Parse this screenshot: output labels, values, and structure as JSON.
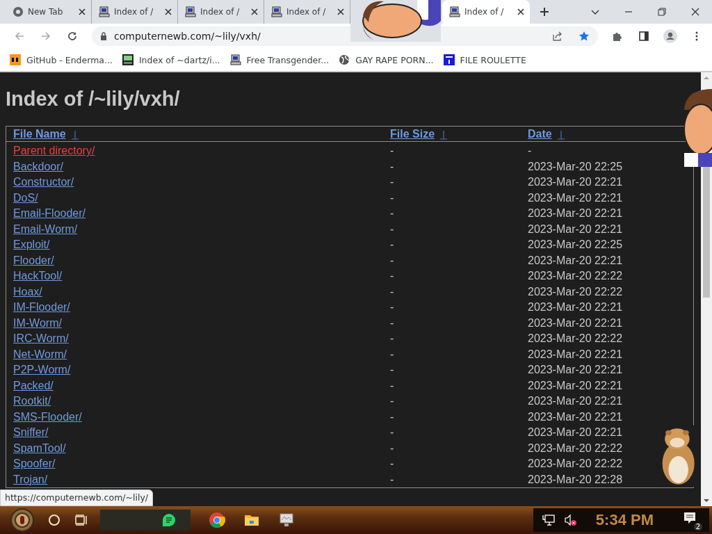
{
  "browser": {
    "tabs": [
      {
        "title": "New Tab",
        "kind": "newtab",
        "selected": false
      },
      {
        "title": "Index of /",
        "kind": "page",
        "selected": false
      },
      {
        "title": "Index of /",
        "kind": "page",
        "selected": false
      },
      {
        "title": "Index of /",
        "kind": "page",
        "selected": false
      },
      {
        "title": "Index of /",
        "kind": "page",
        "selected": true
      }
    ],
    "address": "computernewb.com/~lily/vxh/",
    "bookmarks": [
      {
        "title": "GitHub - Enderma...",
        "kind": "ph"
      },
      {
        "title": "Index of ~dartz/i...",
        "kind": "grid"
      },
      {
        "title": "Free Transgender...",
        "kind": "computer"
      },
      {
        "title": "GAY RAPE PORN...",
        "kind": "globe"
      },
      {
        "title": "FILE ROULETTE",
        "kind": "mft"
      }
    ]
  },
  "page": {
    "title": "Index of /~lily/vxh/",
    "columns": [
      "File Name",
      "File Size",
      "Date"
    ],
    "rows": [
      {
        "name": "Parent directory/",
        "size": "-",
        "date": "-",
        "visited": true
      },
      {
        "name": "Backdoor/",
        "size": "-",
        "date": "2023-Mar-20 22:25",
        "visited": false
      },
      {
        "name": "Constructor/",
        "size": "-",
        "date": "2023-Mar-20 22:21",
        "visited": false
      },
      {
        "name": "DoS/",
        "size": "-",
        "date": "2023-Mar-20 22:21",
        "visited": false
      },
      {
        "name": "Email-Flooder/",
        "size": "-",
        "date": "2023-Mar-20 22:21",
        "visited": false
      },
      {
        "name": "Email-Worm/",
        "size": "-",
        "date": "2023-Mar-20 22:21",
        "visited": false
      },
      {
        "name": "Exploit/",
        "size": "-",
        "date": "2023-Mar-20 22:25",
        "visited": false
      },
      {
        "name": "Flooder/",
        "size": "-",
        "date": "2023-Mar-20 22:21",
        "visited": false
      },
      {
        "name": "HackTool/",
        "size": "-",
        "date": "2023-Mar-20 22:22",
        "visited": false
      },
      {
        "name": "Hoax/",
        "size": "-",
        "date": "2023-Mar-20 22:22",
        "visited": false
      },
      {
        "name": "IM-Flooder/",
        "size": "-",
        "date": "2023-Mar-20 22:21",
        "visited": false
      },
      {
        "name": "IM-Worm/",
        "size": "-",
        "date": "2023-Mar-20 22:21",
        "visited": false
      },
      {
        "name": "IRC-Worm/",
        "size": "-",
        "date": "2023-Mar-20 22:22",
        "visited": false
      },
      {
        "name": "Net-Worm/",
        "size": "-",
        "date": "2023-Mar-20 22:21",
        "visited": false
      },
      {
        "name": "P2P-Worm/",
        "size": "-",
        "date": "2023-Mar-20 22:21",
        "visited": false
      },
      {
        "name": "Packed/",
        "size": "-",
        "date": "2023-Mar-20 22:21",
        "visited": false
      },
      {
        "name": "Rootkit/",
        "size": "-",
        "date": "2023-Mar-20 22:21",
        "visited": false
      },
      {
        "name": "SMS-Flooder/",
        "size": "-",
        "date": "2023-Mar-20 22:21",
        "visited": false
      },
      {
        "name": "Sniffer/",
        "size": "-",
        "date": "2023-Mar-20 22:21",
        "visited": false
      },
      {
        "name": "SpamTool/",
        "size": "-",
        "date": "2023-Mar-20 22:22",
        "visited": false
      },
      {
        "name": "Spoofer/",
        "size": "-",
        "date": "2023-Mar-20 22:22",
        "visited": false
      },
      {
        "name": "Trojan/",
        "size": "-",
        "date": "2023-Mar-20 22:28",
        "visited": false
      }
    ]
  },
  "status_link": "https://computernewb.com/~lily/",
  "taskbar": {
    "clock": "5:34 PM",
    "notifications": "2"
  }
}
